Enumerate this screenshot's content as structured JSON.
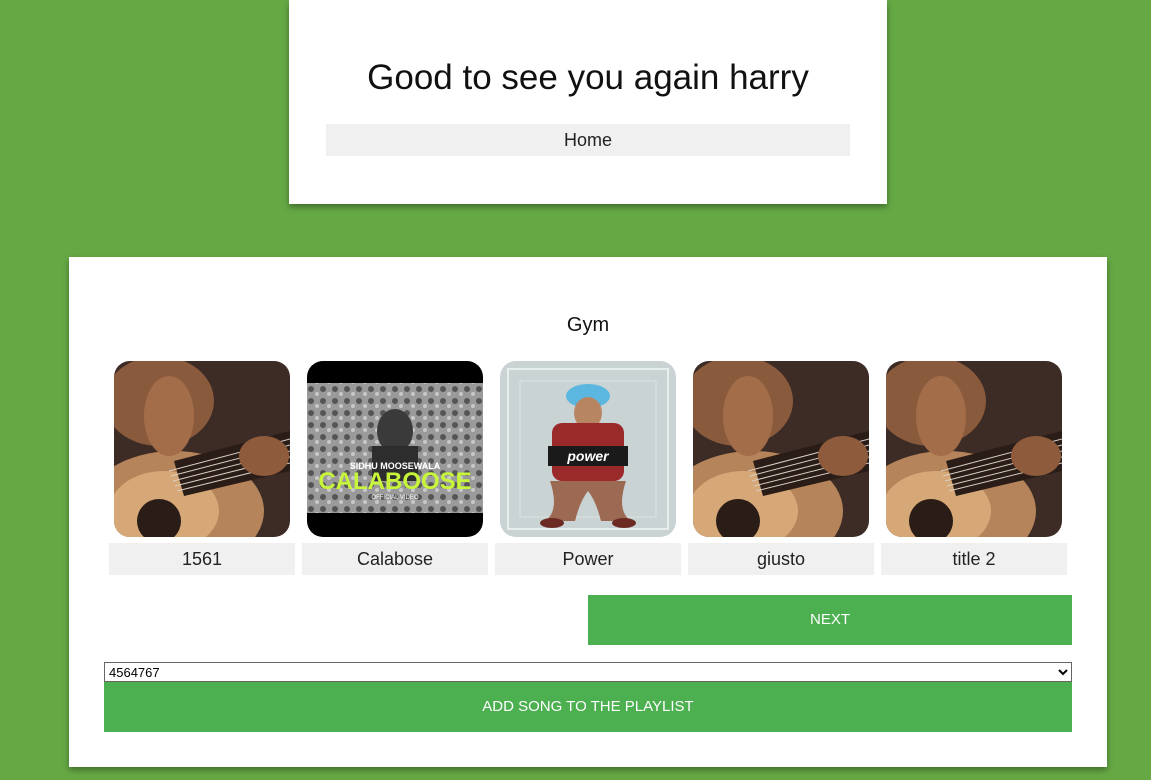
{
  "header": {
    "greeting": "Good to see you again harry",
    "home_label": "Home"
  },
  "playlist": {
    "title": "Gym",
    "songs": [
      {
        "title": "1561",
        "artwork": "guitar-artwork"
      },
      {
        "title": "Calabose",
        "artwork": "calaboose-cover",
        "cover_text": [
          "SIDHU MOOSEWALA",
          "CALABOOSE",
          "OFFICIAL VIDEO"
        ]
      },
      {
        "title": "Power",
        "artwork": "power-cover",
        "cover_text": [
          "power"
        ]
      },
      {
        "title": "giusto",
        "artwork": "guitar-artwork"
      },
      {
        "title": "title 2",
        "artwork": "guitar-artwork"
      }
    ],
    "next_label": "NEXT",
    "select_value": "4564767",
    "add_label": "ADD SONG TO THE PLAYLIST"
  },
  "colors": {
    "background": "#65a844",
    "accent": "#4caf50",
    "label_bg": "#f0f0f0"
  }
}
